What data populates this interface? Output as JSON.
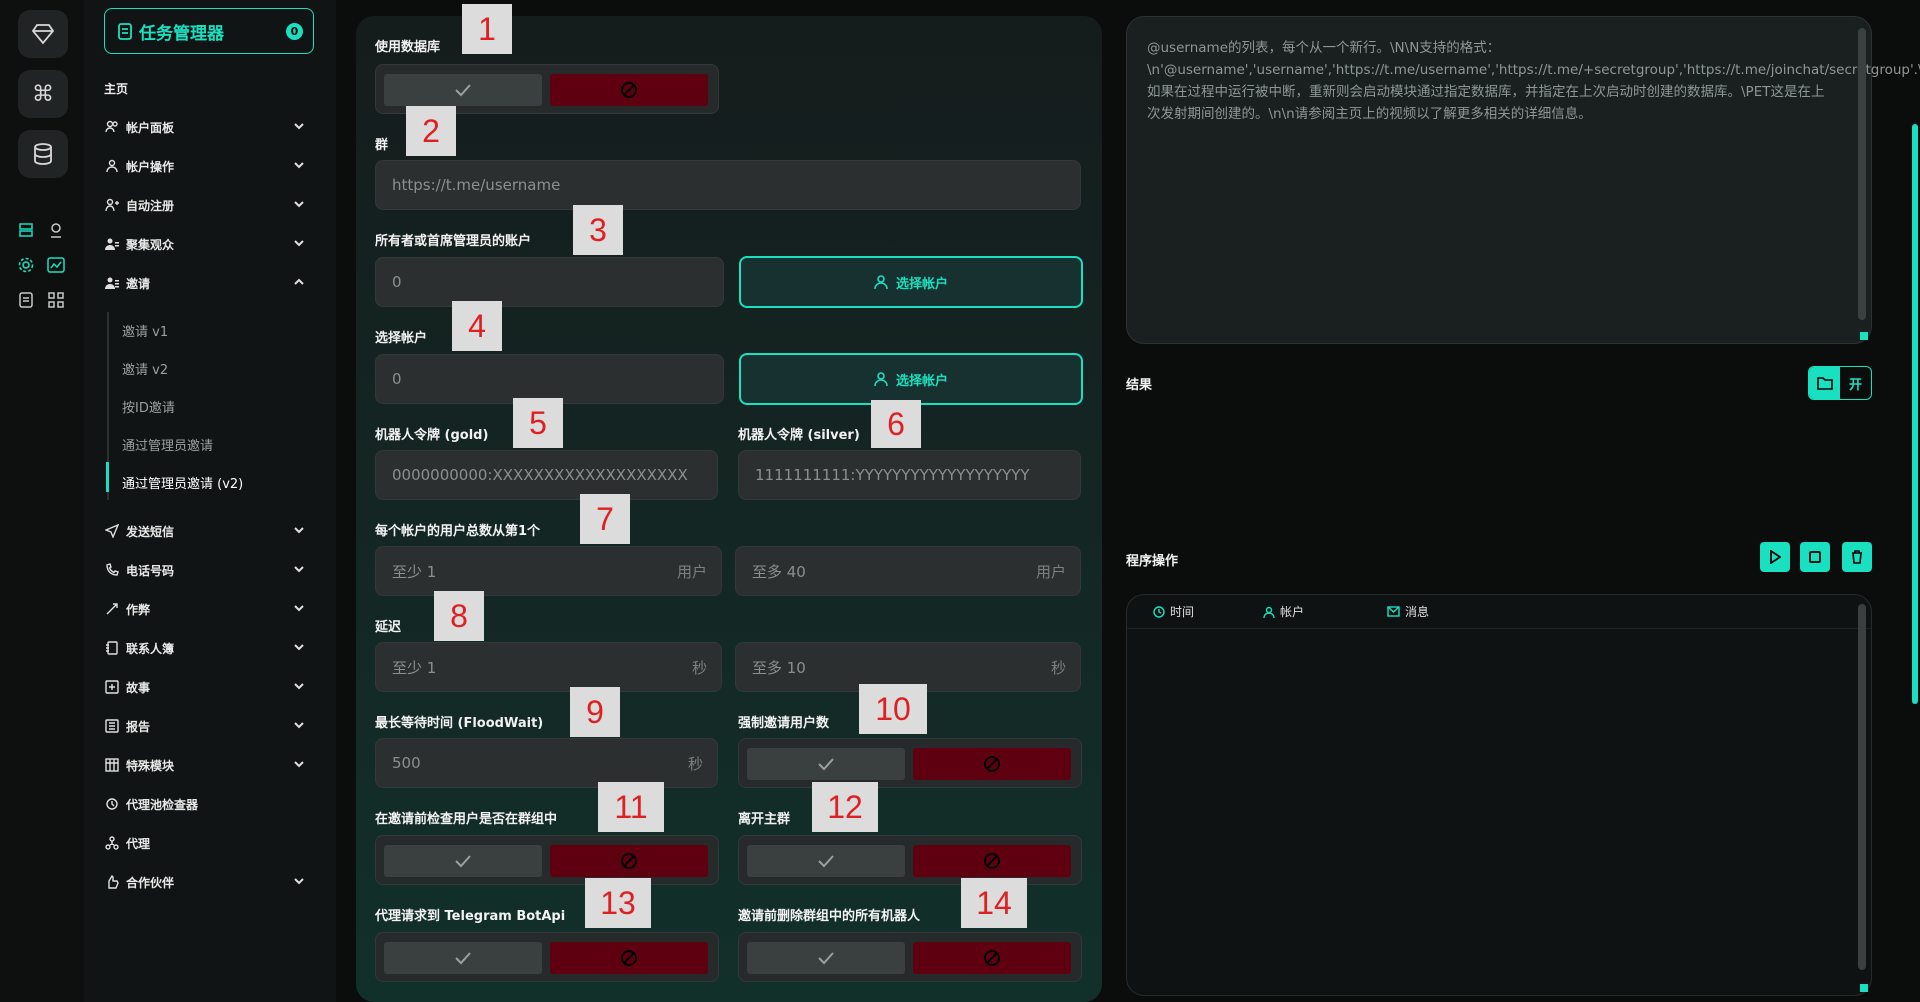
{
  "brand": {
    "title": "任务管理器",
    "badge": "0"
  },
  "sidebar": {
    "section_title": "主页",
    "items": [
      {
        "label": "帐户面板",
        "icon": "users-icon"
      },
      {
        "label": "帐户操作",
        "icon": "user-icon"
      },
      {
        "label": "自动注册",
        "icon": "user-plus-icon"
      },
      {
        "label": "聚集观众",
        "icon": "users-group-icon"
      },
      {
        "label": "邀请",
        "icon": "invite-icon"
      },
      {
        "label": "发送短信",
        "icon": "send-icon"
      },
      {
        "label": "电话号码",
        "icon": "phone-icon"
      },
      {
        "label": "作弊",
        "icon": "cheat-icon"
      },
      {
        "label": "联系人簿",
        "icon": "contacts-icon"
      },
      {
        "label": "故事",
        "icon": "story-icon"
      },
      {
        "label": "报告",
        "icon": "report-icon"
      },
      {
        "label": "特殊模块",
        "icon": "module-icon"
      },
      {
        "label": "代理池检查器",
        "icon": "proxy-check-icon"
      },
      {
        "label": "代理",
        "icon": "proxy-icon"
      },
      {
        "label": "合作伙伴",
        "icon": "partner-icon"
      }
    ],
    "invite_sub": [
      "邀请 v1",
      "邀请 v2",
      "按ID邀请",
      "通过管理员邀请",
      "通过管理员邀请 (v2)"
    ]
  },
  "form": {
    "use_db_label": "使用数据库",
    "group_label": "群",
    "group_placeholder": "https://t.me/username",
    "owner_label": "所有者或首席管理员的账户",
    "owner_value": "0",
    "select_account_btn": "选择帐户",
    "select_label": "选择帐户",
    "select_value": "0",
    "token_gold_label": "机器人令牌 (gold)",
    "token_gold_placeholder": "0000000000:XXXXXXXXXXXXXXXXXXX",
    "token_silver_label": "机器人令牌 (silver)",
    "token_silver_placeholder": "1111111111:YYYYYYYYYYYYYYYYYYY",
    "users_label": "每个帐户的用户总数从第1个",
    "users_min": "至少  1",
    "users_max": "至多  40",
    "users_unit": "用户",
    "delay_label": "延迟",
    "delay_min": "至少  1",
    "delay_max": "至多  10",
    "delay_unit": "秒",
    "flood_label": "最长等待时间 (FloodWait)",
    "flood_value": "500",
    "flood_unit": "秒",
    "force_label": "强制邀请用户数",
    "check_label": "在邀请前检查用户是否在群组中",
    "leave_label": "离开主群",
    "proxy_label": "代理请求到 Telegram BotApi",
    "delete_bots_label": "邀请前删除群组中的所有机器人"
  },
  "markers": [
    "1",
    "2",
    "3",
    "4",
    "5",
    "6",
    "7",
    "8",
    "9",
    "10",
    "11",
    "12",
    "13",
    "14"
  ],
  "description": "@username的列表，每个从一个新行。\\N\\N支持的格式：\\n'@username','username','https://t.me/username','https://t.me/+secretgroup','https://t.me/joinchat/secretgroup'.\\n\\n如果在过程中运行被中断，重新则会启动模块通过指定数据库，并指定在上次启动时创建的数据库。\\PET这是在上次发射期间创建的。\\n\\n请参阅主页上的视频以了解更多相关的详细信息。",
  "results": {
    "label": "结果",
    "open_btn": "开"
  },
  "program": {
    "label": "程序操作"
  },
  "log": {
    "columns": [
      "时间",
      "帐户",
      "消息"
    ]
  },
  "colors": {
    "accent": "#19e0c0",
    "deny": "#5e0010",
    "panel": "#151c1c"
  }
}
